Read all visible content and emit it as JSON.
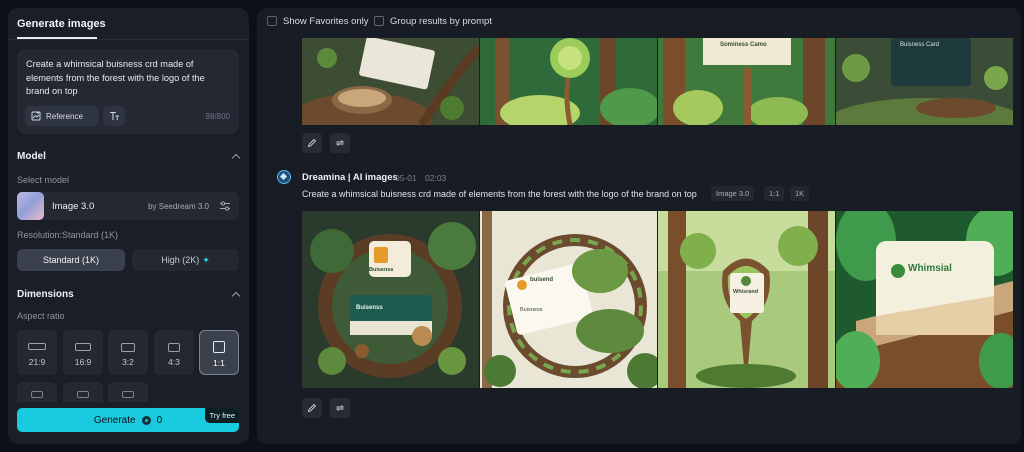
{
  "left_panel": {
    "title": "Generate images",
    "prompt": {
      "text": "Create a whimsical buisness crd made of elements from the forest with the logo of the brand on top",
      "reference_label": "Reference",
      "char_count": "98/800"
    },
    "model_section": {
      "header": "Model",
      "select_label": "Select model",
      "model_name": "Image 3.0",
      "model_by": "by Seedream 3.0"
    },
    "resolution": {
      "label": "Resolution:Standard (1K)",
      "standard": "Standard (1K)",
      "high": "High (2K)",
      "high_icon": "sparkle-icon"
    },
    "dimensions": {
      "header": "Dimensions",
      "aspect_label": "Aspect ratio",
      "ratios": [
        "21:9",
        "16:9",
        "3:2",
        "4:3",
        "1:1"
      ],
      "selected": "1:1"
    },
    "generate": {
      "label": "Generate",
      "cost": "0",
      "badge": "Try free"
    }
  },
  "right_panel": {
    "filters": {
      "favorites": "Show Favorites only",
      "group": "Group results by prompt"
    },
    "top_group": {
      "card_texts": [
        "Sominess Camo",
        "Buisness Card"
      ]
    },
    "generation": {
      "agent": "Dreamina | AI images",
      "date": "05-01",
      "time": "02:03",
      "prompt": "Create a whimsical buisness crd made of elements from the forest with the logo of the brand on top",
      "tags": [
        "Image 3.0",
        "1:1",
        "1K"
      ],
      "card_texts": [
        "Buisenss",
        "Buisenss",
        "buisend",
        "Buisness",
        "Whisrand",
        "Whimsial"
      ]
    }
  },
  "colors": {
    "accent": "#19c9de",
    "background": "#0d1017",
    "panel": "#1a1e26",
    "forest_dark": "#1f4a2e",
    "forest_light": "#e8efd9"
  }
}
